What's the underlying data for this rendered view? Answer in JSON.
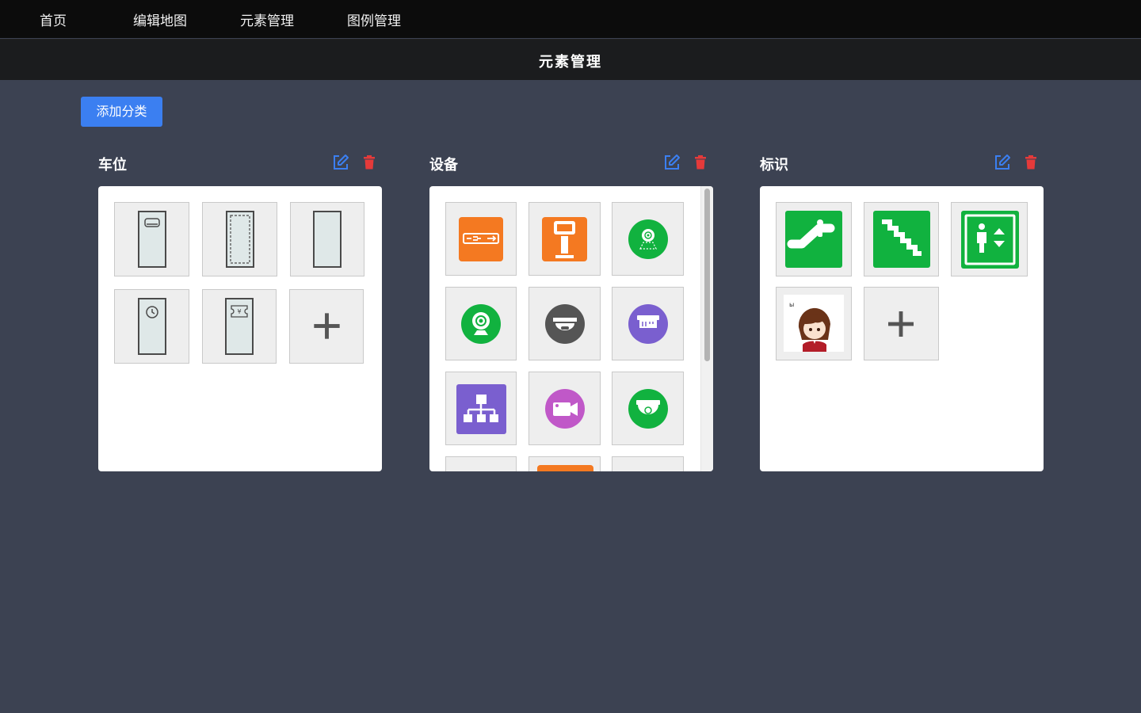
{
  "nav": {
    "items": [
      "首页",
      "编辑地图",
      "元素管理",
      "图例管理"
    ]
  },
  "header": {
    "title": "元素管理"
  },
  "toolbar": {
    "add_category_label": "添加分类"
  },
  "categories": [
    {
      "name": "车位",
      "tiles": [
        "parking-space-sensor-icon",
        "parking-space-dashed-icon",
        "parking-space-plain-icon",
        "parking-space-clock-icon",
        "parking-space-ticket-icon",
        "add-icon"
      ]
    },
    {
      "name": "设备",
      "tiles": [
        "barrier-gate-icon",
        "ticket-machine-icon",
        "camera-dome-icon",
        "webcam-icon",
        "dome-camera-icon",
        "fisheye-camera-icon",
        "network-switch-icon",
        "video-camera-icon",
        "face-camera-icon"
      ]
    },
    {
      "name": "标识",
      "tiles": [
        "escalator-sign-icon",
        "stairs-sign-icon",
        "elevator-sign-icon",
        "avatar-image",
        "add-icon"
      ]
    }
  ],
  "colors": {
    "accent": "#3b7ff1",
    "danger": "#e53a3a",
    "orange": "#f47921",
    "green": "#11b23f",
    "purple": "#7a5fcf",
    "magenta": "#c058c8"
  }
}
